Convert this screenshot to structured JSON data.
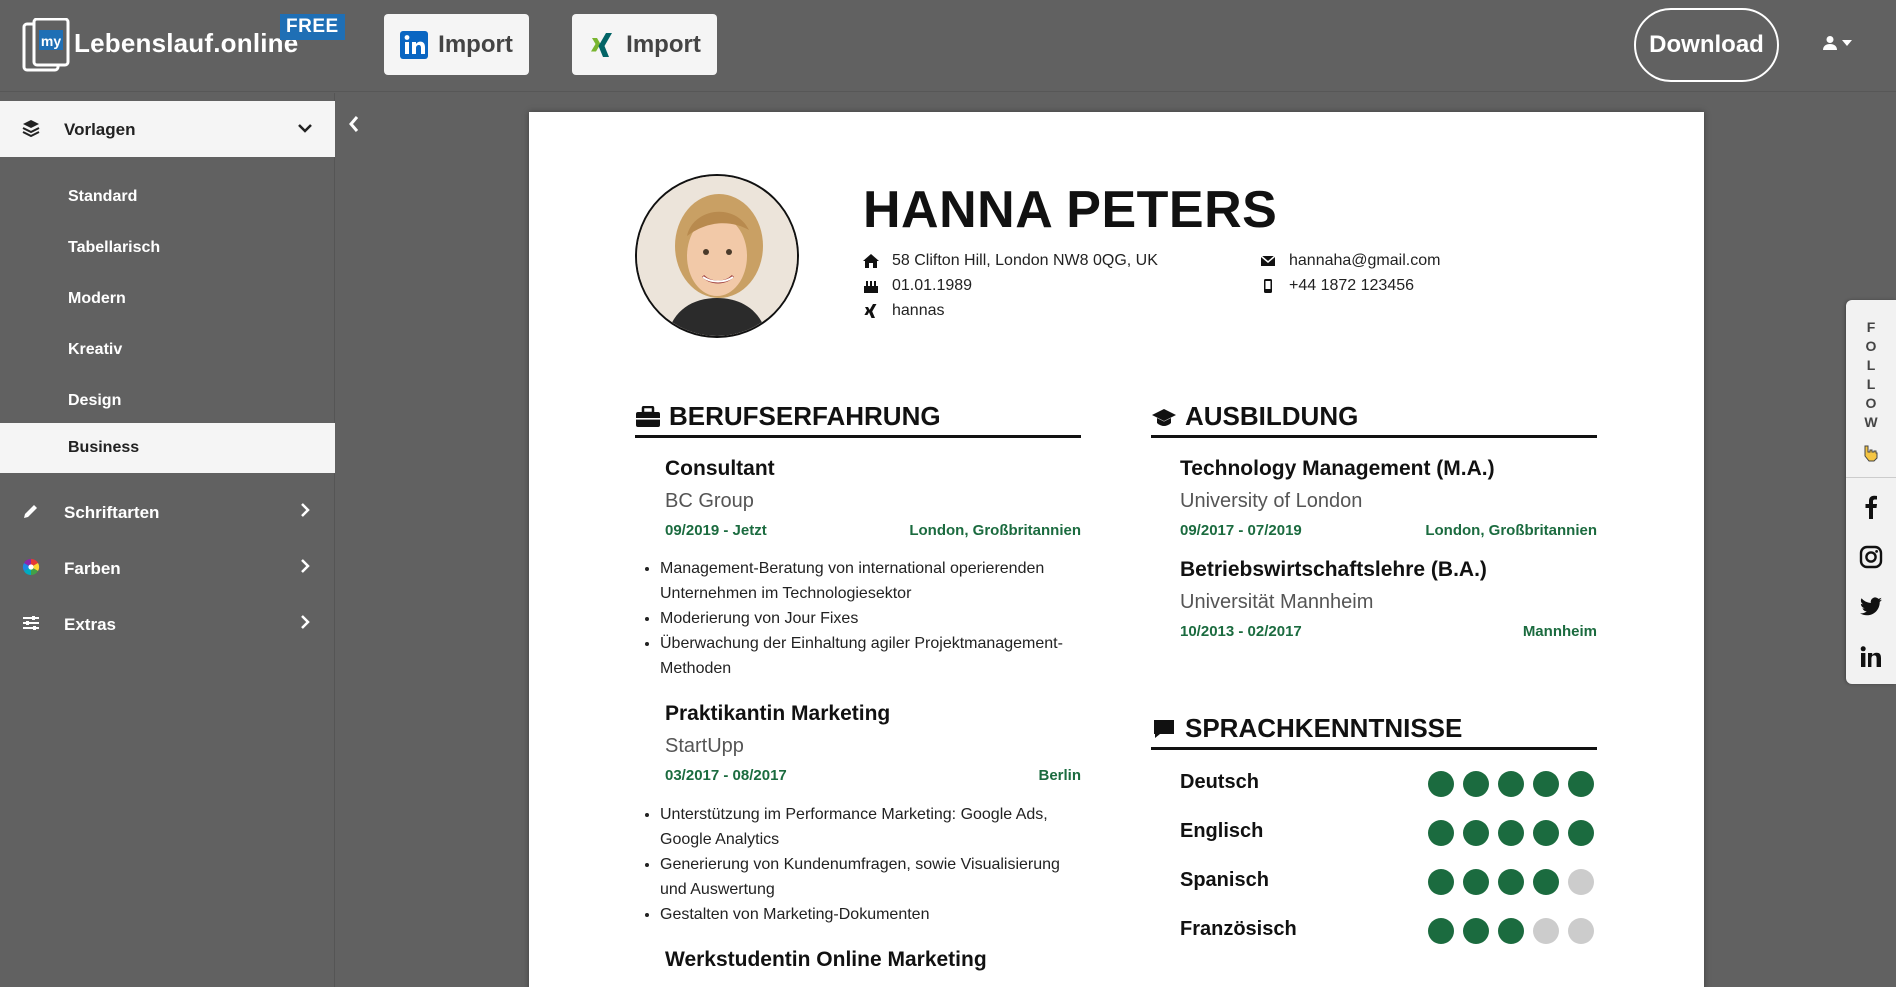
{
  "brand": {
    "name": "Lebenslauf.online",
    "badge": "FREE"
  },
  "toolbar": {
    "import_linkedin": "Import",
    "import_xing": "Import",
    "download": "Download"
  },
  "sidebar": {
    "section": "Vorlagen",
    "templates": [
      "Standard",
      "Tabellarisch",
      "Modern",
      "Kreativ",
      "Design",
      "Business"
    ],
    "active_template": "Business",
    "categories": [
      "Schriftarten",
      "Farben",
      "Extras"
    ]
  },
  "cv": {
    "name": "HANNA PETERS",
    "address": "58 Clifton Hill, London NW8 0QG, UK",
    "birthdate": "01.01.1989",
    "xing": "hannas",
    "email": "hannaha@gmail.com",
    "phone": "+44 1872 123456",
    "experience_title": "BERUFSERFAHRUNG",
    "jobs": [
      {
        "title": "Consultant",
        "company": "BC Group",
        "dates": "09/2019 - Jetzt",
        "location": "London, Großbritannien",
        "bullets": [
          "Management-Beratung von international operierenden Unternehmen im Technologiesektor",
          "Moderierung von Jour Fixes",
          "Überwachung der Einhaltung agiler Projektmanagement-Methoden"
        ]
      },
      {
        "title": "Praktikantin Marketing",
        "company": "StartUpp",
        "dates": "03/2017 - 08/2017",
        "location": "Berlin",
        "bullets": [
          "Unterstützung im Performance Marketing: Google Ads, Google Analytics",
          "Generierung von Kundenumfragen, sowie Visualisierung und Auswertung",
          "Gestalten von Marketing-Dokumenten"
        ]
      },
      {
        "title": "Werkstudentin Online Marketing"
      }
    ],
    "education_title": "AUSBILDUNG",
    "education": [
      {
        "degree": "Technology Management (M.A.)",
        "school": "University of London",
        "dates": "09/2017 - 07/2019",
        "location": "London, Großbritannien"
      },
      {
        "degree": "Betriebswirtschaftslehre (B.A.)",
        "school": "Universität Mannheim",
        "dates": "10/2013 - 02/2017",
        "location": "Mannheim"
      }
    ],
    "languages_title": "SPRACHKENNTNISSE",
    "languages": [
      {
        "name": "Deutsch",
        "level": 5,
        "max": 5
      },
      {
        "name": "Englisch",
        "level": 5,
        "max": 5
      },
      {
        "name": "Spanisch",
        "level": 4,
        "max": 5
      },
      {
        "name": "Französisch",
        "level": 3,
        "max": 5
      }
    ]
  },
  "follow": {
    "label": "FOLLOW",
    "networks": [
      "facebook",
      "instagram",
      "twitter",
      "linkedin"
    ]
  },
  "colors": {
    "accent": "#1b6b3f",
    "chrome": "#616161",
    "linkedin": "#0a66c2",
    "xing": "#026466",
    "badge": "#1f6fb5"
  }
}
